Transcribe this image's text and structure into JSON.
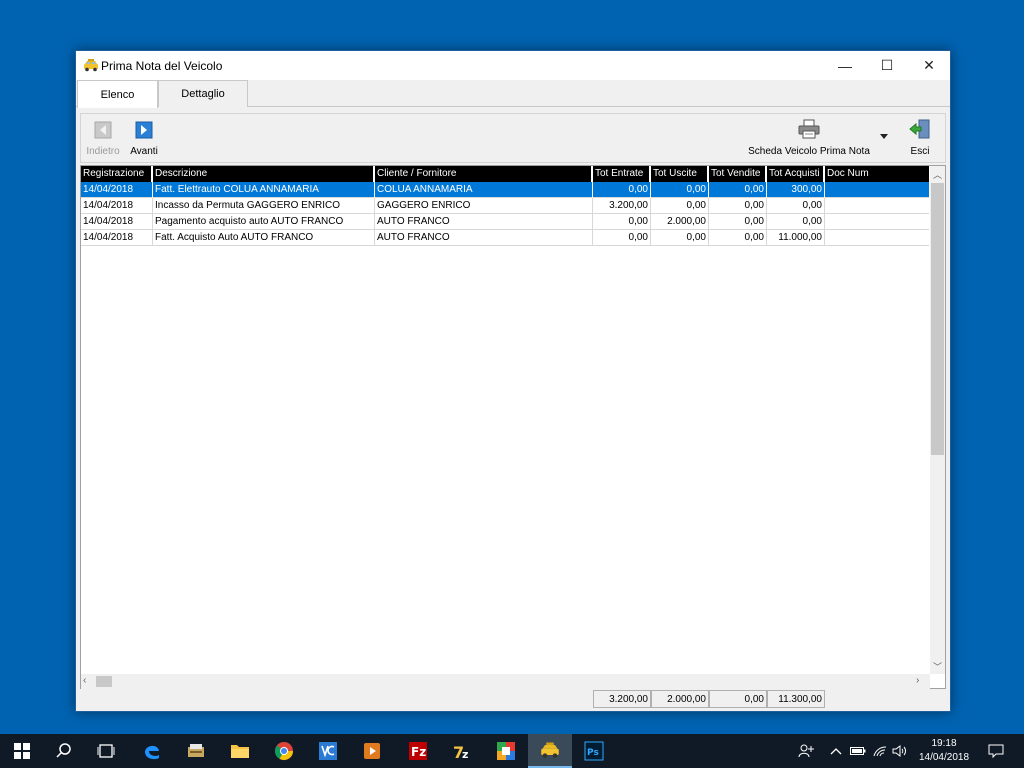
{
  "window": {
    "title": "Prima Nota del Veicolo",
    "minimize_glyph": "—",
    "maximize_glyph": "☐",
    "close_glyph": "✕"
  },
  "tabs": [
    {
      "label": "Elenco",
      "active": true
    },
    {
      "label": "Dettaglio",
      "active": false
    }
  ],
  "toolbar": {
    "back_label": "Indietro",
    "next_label": "Avanti",
    "print_label": "Scheda Veicolo Prima Nota",
    "exit_label": "Esci"
  },
  "grid": {
    "columns": [
      "Registrazione",
      "Descrizione",
      "Cliente / Fornitore",
      "Tot Entrate",
      "Tot Uscite",
      "Tot Vendite",
      "Tot Acquisti",
      "Doc Num"
    ],
    "rows": [
      {
        "registrazione": "14/04/2018",
        "descrizione": "Fatt. Elettrauto COLUA ANNAMARIA",
        "cliente": "COLUA ANNAMARIA",
        "entrate": "0,00",
        "uscite": "0,00",
        "vendite": "0,00",
        "acquisti": "300,00",
        "doc": ""
      },
      {
        "registrazione": "14/04/2018",
        "descrizione": "Incasso da Permuta GAGGERO ENRICO",
        "cliente": "GAGGERO ENRICO",
        "entrate": "3.200,00",
        "uscite": "0,00",
        "vendite": "0,00",
        "acquisti": "0,00",
        "doc": ""
      },
      {
        "registrazione": "14/04/2018",
        "descrizione": "Pagamento acquisto auto AUTO FRANCO",
        "cliente": "AUTO FRANCO",
        "entrate": "0,00",
        "uscite": "2.000,00",
        "vendite": "0,00",
        "acquisti": "0,00",
        "doc": ""
      },
      {
        "registrazione": "14/04/2018",
        "descrizione": "Fatt. Acquisto Auto AUTO FRANCO",
        "cliente": "AUTO FRANCO",
        "entrate": "0,00",
        "uscite": "0,00",
        "vendite": "0,00",
        "acquisti": "11.000,00",
        "doc": ""
      }
    ]
  },
  "totals": {
    "entrate": "3.200,00",
    "uscite": "2.000,00",
    "vendite": "0,00",
    "acquisti": "11.300,00"
  },
  "taskbar": {
    "clock_time": "19:18",
    "clock_date": "14/04/2018"
  },
  "colors": {
    "desktop": "#0063b1",
    "selection": "#0078d7",
    "taskbar": "#101a26"
  }
}
